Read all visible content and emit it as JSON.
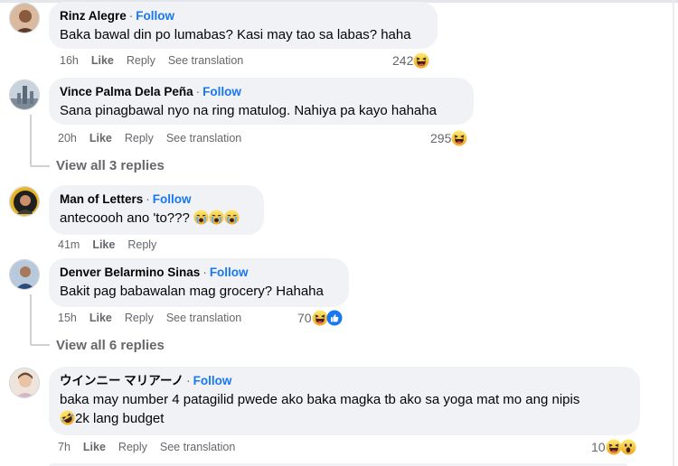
{
  "comments": [
    {
      "name": "Rinz Alegre",
      "follow": "Follow",
      "text": "Baka bawal din po lumabas? Kasi may tao sa labas? haha",
      "time": "16h",
      "like": "Like",
      "reply": "Reply",
      "see_translation": "See translation",
      "reactions": "242"
    },
    {
      "name": "Vince Palma Dela Peña",
      "follow": "Follow",
      "text": "Sana pinagbawal nyo na ring matulog. Nahiya pa kayo hahaha",
      "time": "20h",
      "like": "Like",
      "reply": "Reply",
      "see_translation": "See translation",
      "reactions": "295",
      "view_replies": "View all 3 replies"
    },
    {
      "name": "Man of Letters",
      "follow": "Follow",
      "text": "antecoooh ano 'to???",
      "time": "41m",
      "like": "Like",
      "reply": "Reply"
    },
    {
      "name": "Denver Belarmino Sinas",
      "follow": "Follow",
      "text": "Bakit pag babawalan mag grocery? Hahaha",
      "time": "15h",
      "like": "Like",
      "reply": "Reply",
      "see_translation": "See translation",
      "reactions": "70",
      "view_replies": "View all 6 replies"
    },
    {
      "name": "ウインニー マリアーノ",
      "follow": "Follow",
      "text_line1": "baka may number 4 patagilid pwede ako baka magka tb ako sa yoga mat mo ang nipis",
      "text_line2": "2k lang budget",
      "time": "7h",
      "like": "Like",
      "reply": "Reply",
      "see_translation": "See translation",
      "reactions": "10"
    }
  ],
  "icons": {
    "haha": "haha-reaction-icon",
    "like": "like-reaction-icon",
    "wow": "wow-reaction-icon",
    "crying": "loudly-crying-face-icon",
    "rofl": "rolling-on-floor-laughing-icon"
  },
  "colors": {
    "follow": "#1877f2",
    "bubble": "#f0f2f5",
    "meta": "#65676b",
    "reaction_yellow": "#f7b125"
  }
}
